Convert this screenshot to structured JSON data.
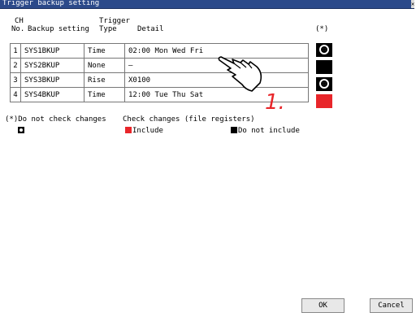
{
  "window": {
    "title": "Trigger backup setting"
  },
  "table": {
    "headers": {
      "ch_line1": "CH",
      "ch_line2": "No.",
      "backup": "Backup setting",
      "trigger_line1": "Trigger",
      "trigger_line2": "Type",
      "detail": "Detail",
      "flag": "(*)"
    },
    "rows": [
      {
        "no": "1",
        "backup": "SYS1BKUP",
        "type": "Time",
        "detail": "02:00 Mon Wed Fri",
        "flag": "radio-icon"
      },
      {
        "no": "2",
        "backup": "SYS2BKUP",
        "type": "None",
        "detail": "—",
        "flag": "black"
      },
      {
        "no": "3",
        "backup": "SYS3BKUP",
        "type": "Rise",
        "detail": "X0100",
        "flag": "radio-icon"
      },
      {
        "no": "4",
        "backup": "SYS4BKUP",
        "type": "Time",
        "detail": "12:00 Tue Thu Sat",
        "flag": "red"
      }
    ]
  },
  "legend": {
    "no_check": "(*)Do not check changes",
    "check": "Check changes (file registers)",
    "include": "Include",
    "not_include": "Do not include"
  },
  "buttons": {
    "ok": "OK",
    "cancel": "Cancel"
  },
  "annotation": {
    "step": "1."
  },
  "colors": {
    "accent_red": "#e8262a",
    "title_bar": "#2c4a8a"
  }
}
